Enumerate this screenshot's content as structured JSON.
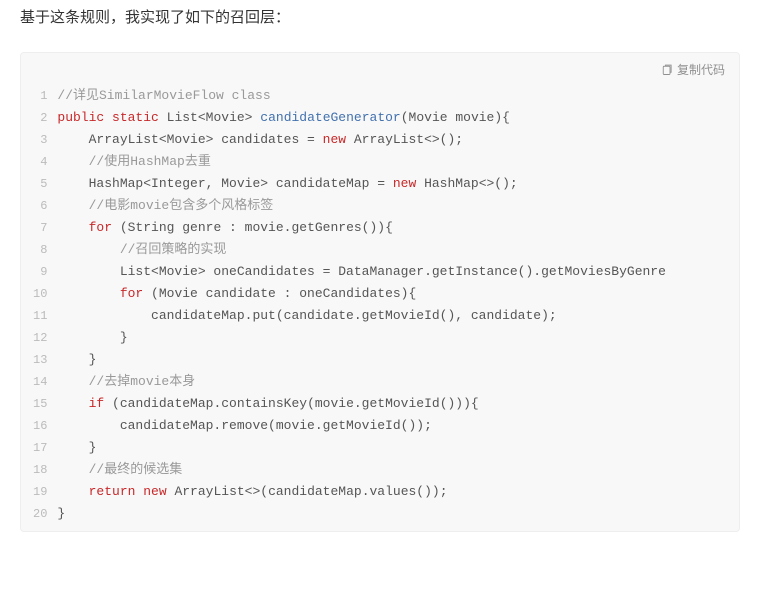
{
  "intro": "基于这条规则，我实现了如下的召回层：",
  "copy_label": "复制代码",
  "lines": [
    {
      "n": "1",
      "segs": [
        {
          "cls": "tok-comment",
          "t": "//详见SimilarMovieFlow class"
        }
      ]
    },
    {
      "n": "2",
      "segs": [
        {
          "cls": "tok-keyword",
          "t": "public"
        },
        {
          "cls": "",
          "t": " "
        },
        {
          "cls": "tok-keyword",
          "t": "static"
        },
        {
          "cls": "",
          "t": " "
        },
        {
          "cls": "tok-type",
          "t": "List<Movie>"
        },
        {
          "cls": "",
          "t": " "
        },
        {
          "cls": "tok-funcdef",
          "t": "candidateGenerator"
        },
        {
          "cls": "",
          "t": "(Movie movie){"
        }
      ]
    },
    {
      "n": "3",
      "segs": [
        {
          "cls": "",
          "t": "    ArrayList<Movie> candidates = "
        },
        {
          "cls": "tok-new",
          "t": "new"
        },
        {
          "cls": "",
          "t": " ArrayList<>();"
        }
      ]
    },
    {
      "n": "4",
      "segs": [
        {
          "cls": "",
          "t": "    "
        },
        {
          "cls": "tok-comment",
          "t": "//使用HashMap去重"
        }
      ]
    },
    {
      "n": "5",
      "segs": [
        {
          "cls": "",
          "t": "    HashMap<Integer, Movie> candidateMap = "
        },
        {
          "cls": "tok-new",
          "t": "new"
        },
        {
          "cls": "",
          "t": " HashMap<>();"
        }
      ]
    },
    {
      "n": "6",
      "segs": [
        {
          "cls": "",
          "t": "    "
        },
        {
          "cls": "tok-comment",
          "t": "//电影movie包含多个风格标签"
        }
      ]
    },
    {
      "n": "7",
      "segs": [
        {
          "cls": "",
          "t": "    "
        },
        {
          "cls": "tok-keyword",
          "t": "for"
        },
        {
          "cls": "",
          "t": " (String genre : movie.getGenres()){"
        }
      ]
    },
    {
      "n": "8",
      "segs": [
        {
          "cls": "",
          "t": "        "
        },
        {
          "cls": "tok-comment",
          "t": "//召回策略的实现"
        }
      ]
    },
    {
      "n": "9",
      "segs": [
        {
          "cls": "",
          "t": "        List<Movie> oneCandidates = DataManager.getInstance().getMoviesByGenre"
        }
      ]
    },
    {
      "n": "10",
      "segs": [
        {
          "cls": "",
          "t": "        "
        },
        {
          "cls": "tok-keyword",
          "t": "for"
        },
        {
          "cls": "",
          "t": " (Movie candidate : oneCandidates){"
        }
      ]
    },
    {
      "n": "11",
      "segs": [
        {
          "cls": "",
          "t": "            candidateMap.put(candidate.getMovieId(), candidate);"
        }
      ]
    },
    {
      "n": "12",
      "segs": [
        {
          "cls": "",
          "t": "        }"
        }
      ]
    },
    {
      "n": "13",
      "segs": [
        {
          "cls": "",
          "t": "    }"
        }
      ]
    },
    {
      "n": "14",
      "segs": [
        {
          "cls": "",
          "t": "    "
        },
        {
          "cls": "tok-comment",
          "t": "//去掉movie本身"
        }
      ]
    },
    {
      "n": "15",
      "segs": [
        {
          "cls": "",
          "t": "    "
        },
        {
          "cls": "tok-keyword",
          "t": "if"
        },
        {
          "cls": "",
          "t": " (candidateMap.containsKey(movie.getMovieId())){"
        }
      ]
    },
    {
      "n": "16",
      "segs": [
        {
          "cls": "",
          "t": "        candidateMap.remove(movie.getMovieId());"
        }
      ]
    },
    {
      "n": "17",
      "segs": [
        {
          "cls": "",
          "t": "    }"
        }
      ]
    },
    {
      "n": "18",
      "segs": [
        {
          "cls": "",
          "t": "    "
        },
        {
          "cls": "tok-comment",
          "t": "//最终的候选集"
        }
      ]
    },
    {
      "n": "19",
      "segs": [
        {
          "cls": "",
          "t": "    "
        },
        {
          "cls": "tok-keyword",
          "t": "return"
        },
        {
          "cls": "",
          "t": " "
        },
        {
          "cls": "tok-new",
          "t": "new"
        },
        {
          "cls": "",
          "t": " ArrayList<>(candidateMap.values());"
        }
      ]
    },
    {
      "n": "20",
      "segs": [
        {
          "cls": "",
          "t": "}"
        }
      ]
    }
  ]
}
